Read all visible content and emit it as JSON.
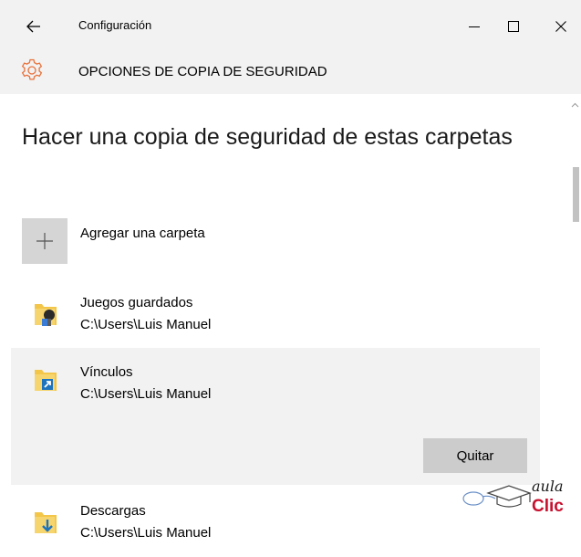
{
  "titlebar": {
    "title": "Configuración",
    "back_icon": "back-arrow-icon",
    "minimize_icon": "minimize-icon",
    "maximize_icon": "maximize-icon",
    "close_icon": "close-icon"
  },
  "header": {
    "icon": "gear-icon",
    "title": "OPCIONES DE COPIA DE SEGURIDAD",
    "accent_color": "#e8713a"
  },
  "main": {
    "title": "Hacer una copia de seguridad de estas carpetas",
    "add_folder": {
      "icon": "plus-icon",
      "label": "Agregar una carpeta"
    },
    "folders": [
      {
        "name": "Juegos guardados",
        "path": "C:\\Users\\Luis Manuel",
        "icon": "saved-games-folder-icon",
        "selected": false
      },
      {
        "name": "Vínculos",
        "path": "C:\\Users\\Luis Manuel",
        "icon": "links-folder-icon",
        "selected": true,
        "action_label": "Quitar"
      },
      {
        "name": "Descargas",
        "path": "C:\\Users\\Luis Manuel",
        "icon": "downloads-folder-icon",
        "selected": false
      }
    ]
  },
  "watermark": {
    "line1": "aula",
    "line2": "Clic",
    "icon": "mouse-mortarboard-logo"
  },
  "colors": {
    "titlebar_bg": "#f2f2f2",
    "selected_bg": "#f2f2f2",
    "button_bg": "#cccccc",
    "add_box_bg": "#d5d5d5",
    "folder_yellow": "#f3c64a",
    "link_blue": "#1e73be",
    "watermark_red": "#c8102e"
  }
}
